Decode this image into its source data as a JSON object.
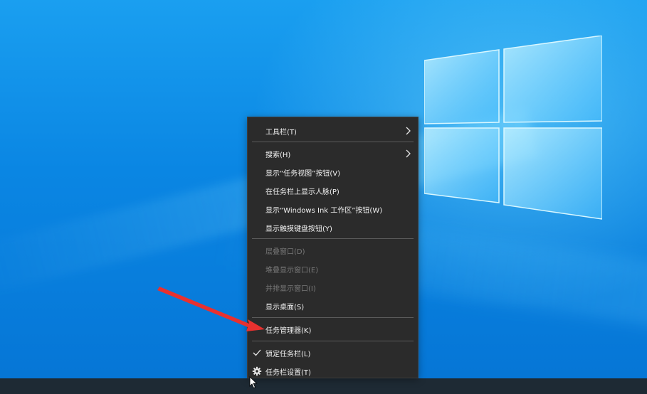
{
  "colors": {
    "menu_bg": "#2b2b2b",
    "menu_text": "#f2f2f2",
    "menu_disabled_text": "#7a7a7a",
    "annotation_arrow": "#e8312f",
    "taskbar": "#1e2a34"
  },
  "context_menu": {
    "items": [
      {
        "label": "工具栏(T)",
        "submenu": true,
        "enabled": true
      },
      {
        "label": "搜索(H)",
        "submenu": true,
        "enabled": true
      },
      {
        "label": "显示“任务视图”按钮(V)",
        "enabled": true
      },
      {
        "label": "在任务栏上显示人脉(P)",
        "enabled": true
      },
      {
        "label": "显示“Windows Ink 工作区”按钮(W)",
        "enabled": true
      },
      {
        "label": "显示触摸键盘按钮(Y)",
        "enabled": true
      },
      {
        "label": "层叠窗口(D)",
        "enabled": false
      },
      {
        "label": "堆叠显示窗口(E)",
        "enabled": false
      },
      {
        "label": "并排显示窗口(I)",
        "enabled": false
      },
      {
        "label": "显示桌面(S)",
        "enabled": true
      },
      {
        "label": "任务管理器(K)",
        "enabled": true
      },
      {
        "label": "锁定任务栏(L)",
        "enabled": true,
        "checked": true,
        "icon": "checkmark-icon"
      },
      {
        "label": "任务栏设置(T)",
        "enabled": true,
        "icon": "gear-icon"
      }
    ]
  }
}
